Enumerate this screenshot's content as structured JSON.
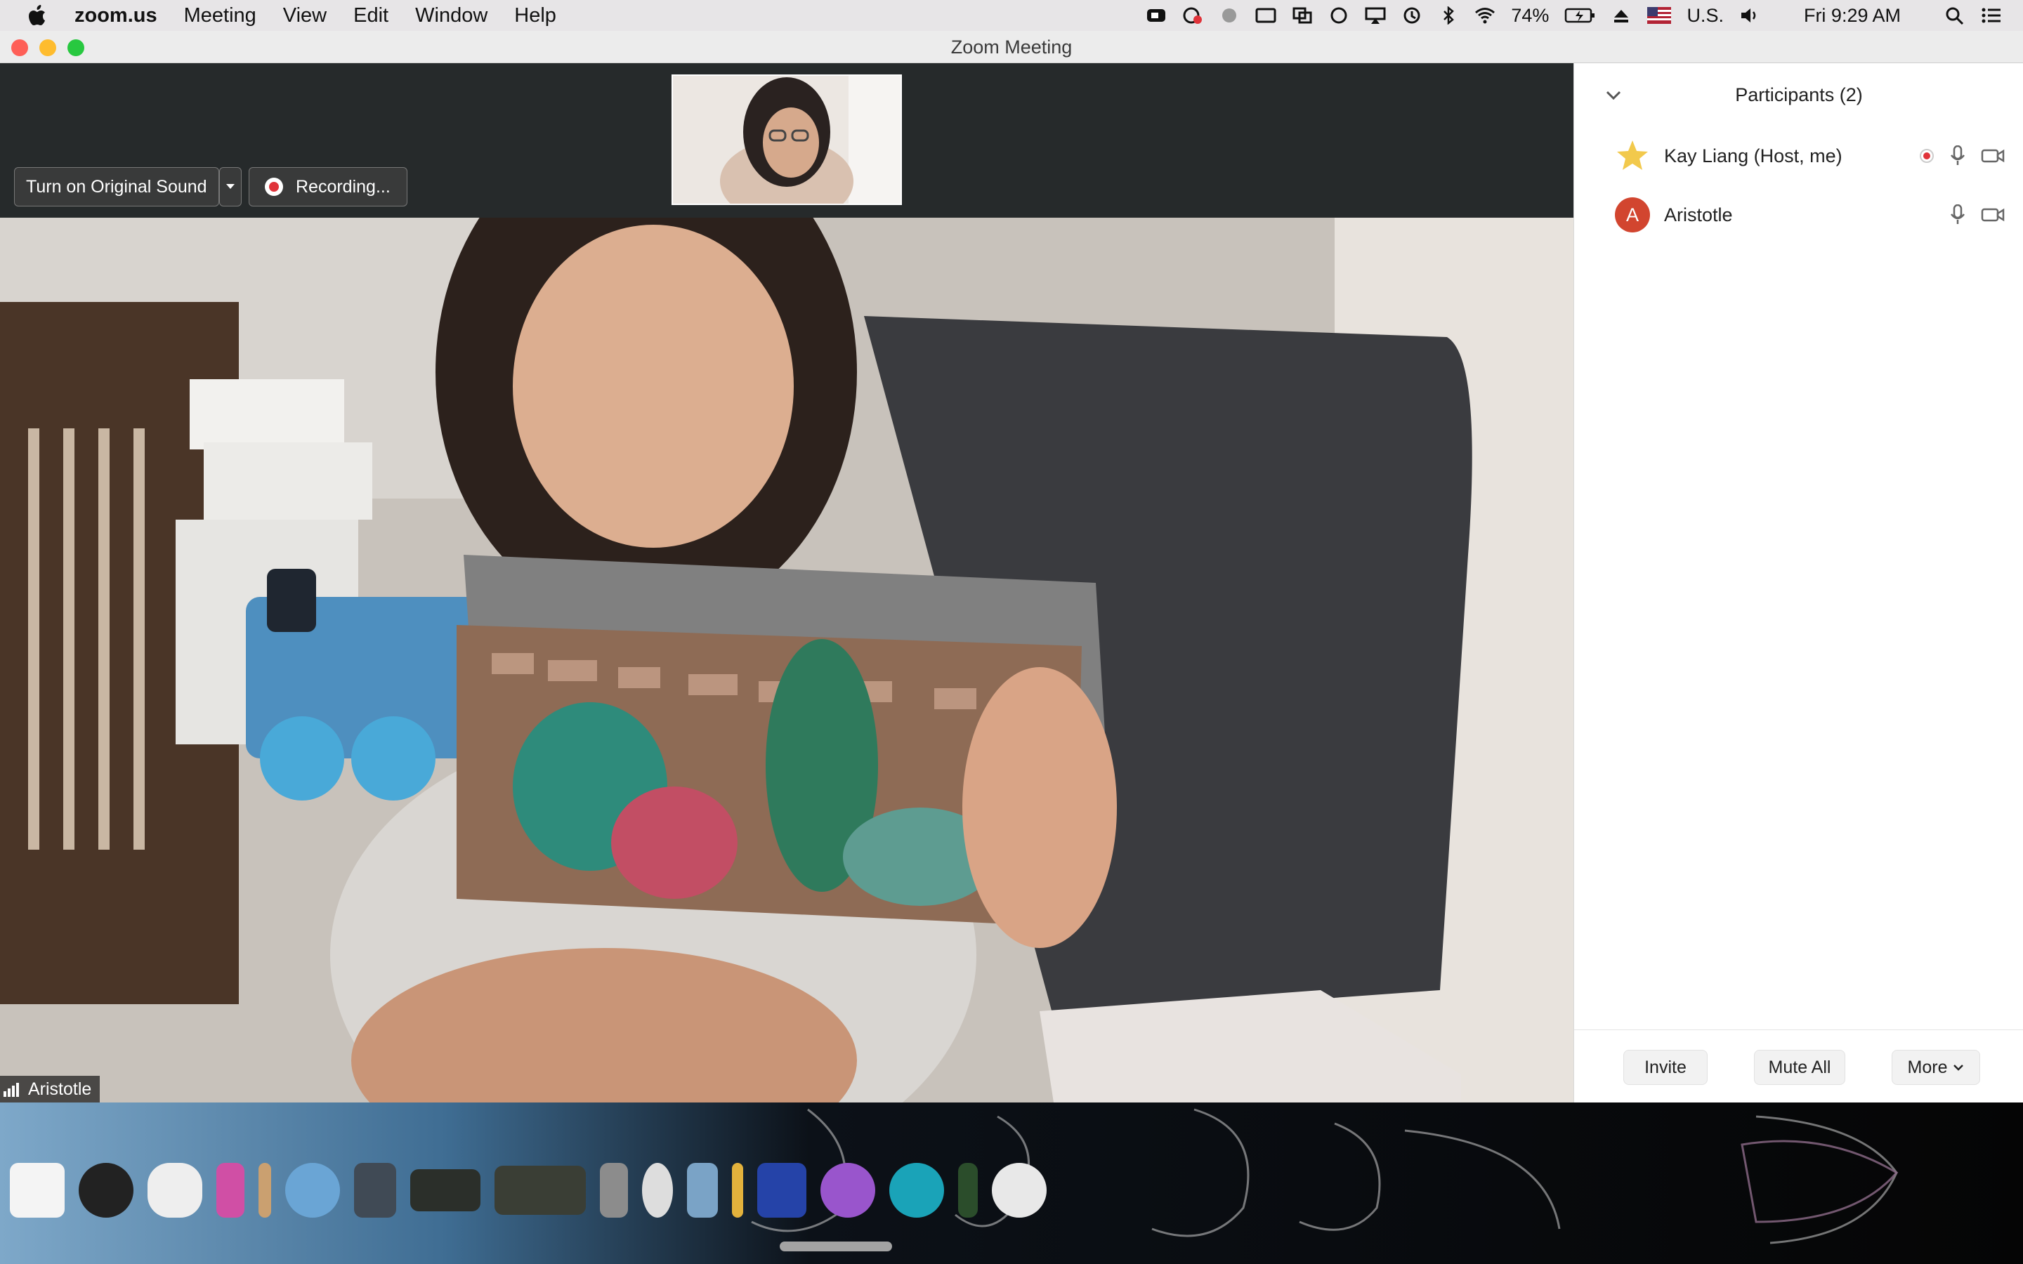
{
  "menubar": {
    "app_name": "zoom.us",
    "items": [
      "Meeting",
      "View",
      "Edit",
      "Window",
      "Help"
    ],
    "battery": "74%",
    "input_source": "U.S.",
    "clock": "Fri 9:29 AM"
  },
  "window": {
    "title": "Zoom Meeting"
  },
  "video": {
    "original_sound_label": "Turn on Original Sound",
    "recording_label": "Recording...",
    "active_speaker_name": "Aristotle"
  },
  "participants": {
    "title": "Participants (2)",
    "list": [
      {
        "name": "Kay Liang (Host, me)",
        "avatar": "star-avatar",
        "recording": true
      },
      {
        "name": "Aristotle",
        "avatar_letter": "A",
        "avatar_color": "#d2452f",
        "recording": false
      }
    ],
    "invite_label": "Invite",
    "mute_all_label": "Mute All",
    "more_label": "More"
  },
  "colors": {
    "record_red": "#e0333a",
    "avatar_red": "#d2452f"
  }
}
